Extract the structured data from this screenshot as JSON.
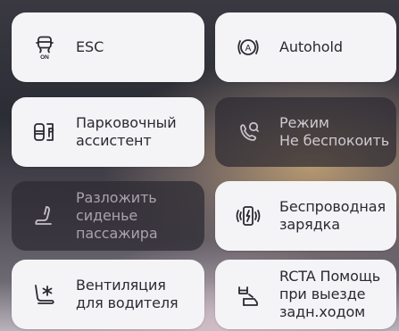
{
  "tiles": [
    {
      "label": "ESC",
      "icon": "esc-off-icon",
      "active": true
    },
    {
      "label": "Autohold",
      "icon": "autohold-icon",
      "active": true
    },
    {
      "label": "Парковочный\nассистент",
      "icon": "parking-assist-icon",
      "active": true
    },
    {
      "label": "Режим\nНе беспокоить",
      "icon": "do-not-disturb-phone-icon",
      "active": false
    },
    {
      "label": "Разложить\nсиденье\nпассажира",
      "icon": "passenger-seat-recline-icon",
      "active": false
    },
    {
      "label": "Беспроводная\nзарядка",
      "icon": "wireless-charging-icon",
      "active": true
    },
    {
      "label": "Вентиляция\nдля водителя",
      "icon": "driver-seat-ventilation-icon",
      "active": true
    },
    {
      "label": "RCTA Помощь\nпри выезде\nзадн.ходом",
      "icon": "rear-cross-traffic-alert-icon",
      "active": true
    }
  ],
  "esc_icon_text": "ON",
  "autohold_icon_text": "A"
}
